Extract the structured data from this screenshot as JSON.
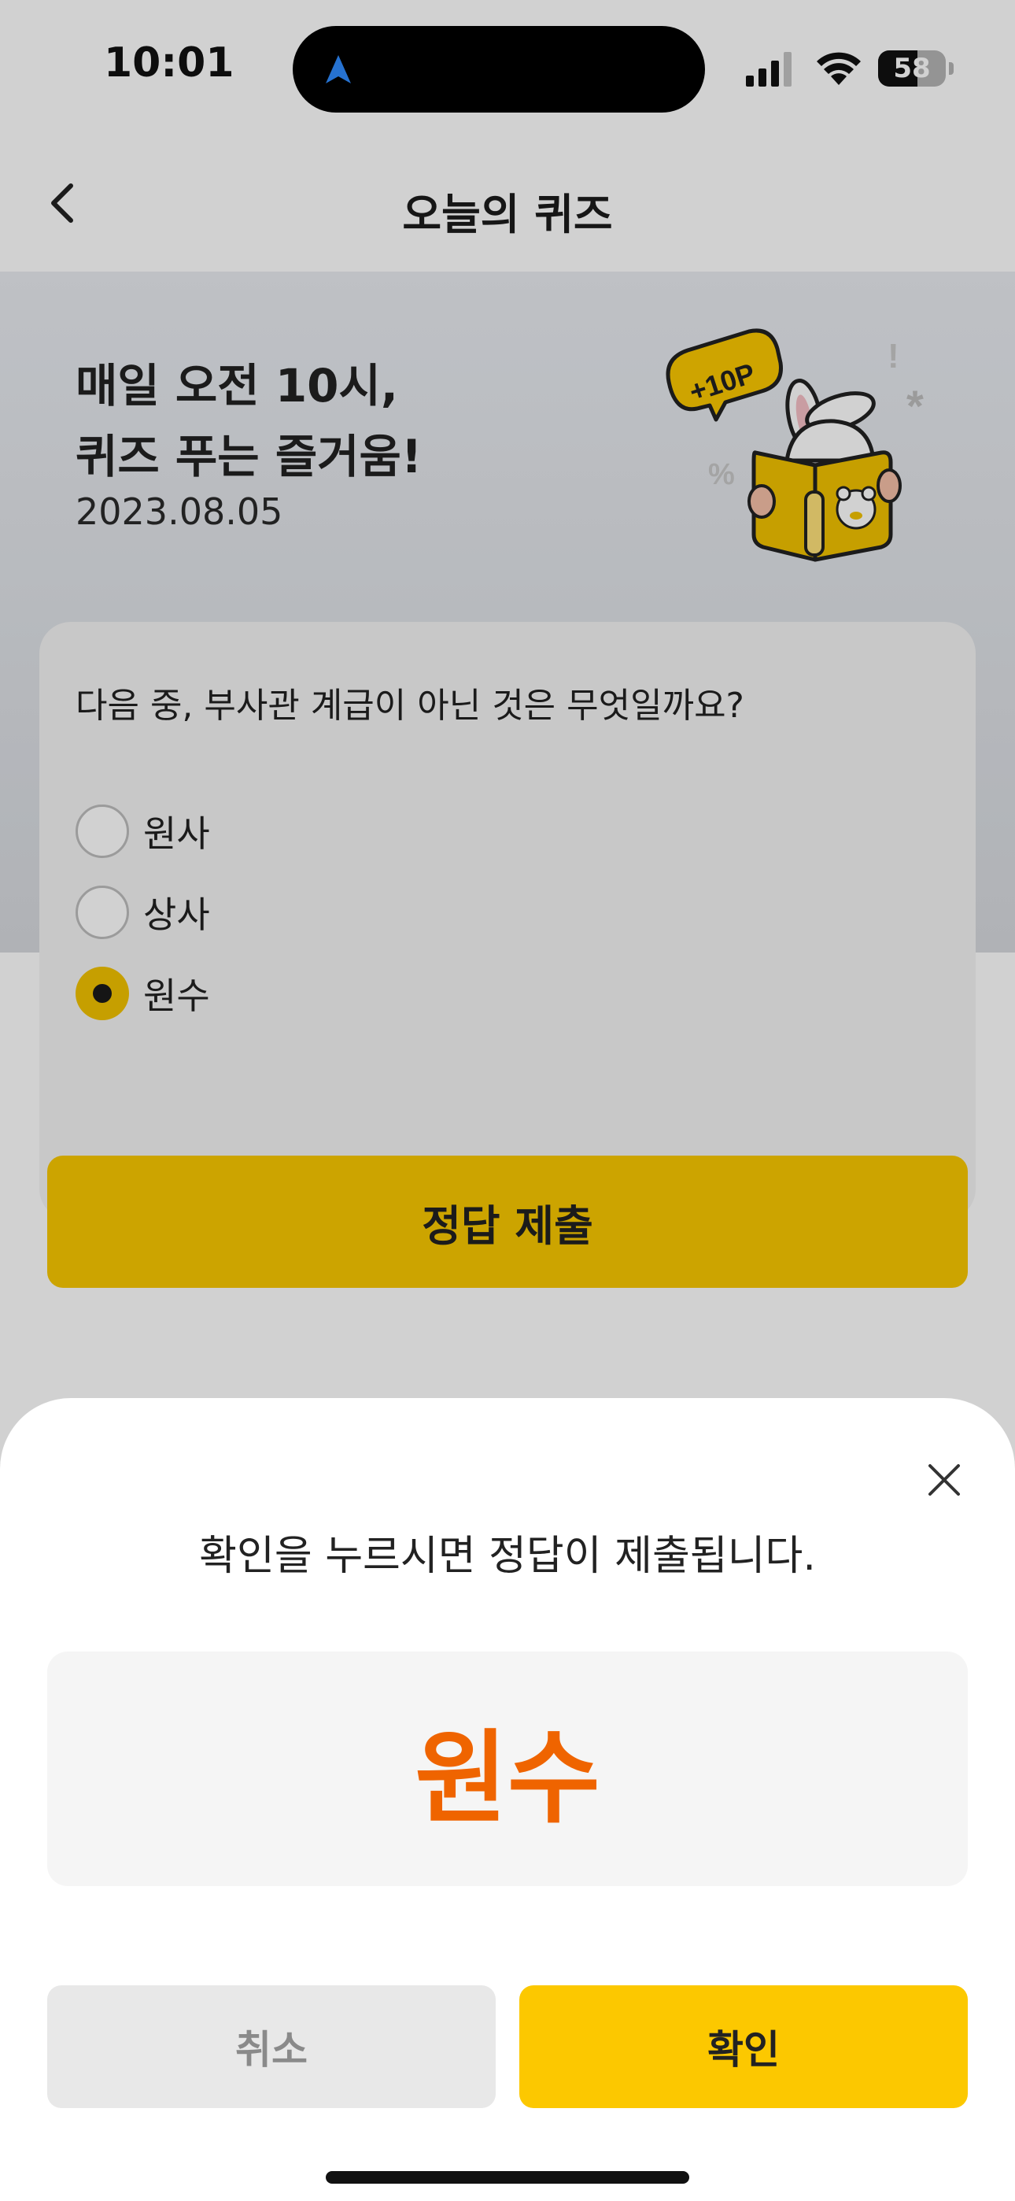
{
  "status_bar": {
    "time": "10:01",
    "battery": "58",
    "battery_level": 0.58
  },
  "nav": {
    "title": "오늘의 퀴즈"
  },
  "hero": {
    "title": "매일 오전 10시,\n퀴즈 푸는 즐거움!",
    "date": "2023.08.05",
    "badge": "+10P"
  },
  "quiz": {
    "question": "다음 중, 부사관 계급이 아닌 것은 무엇일까요?",
    "options": [
      {
        "label": "원사",
        "selected": false
      },
      {
        "label": "상사",
        "selected": false
      },
      {
        "label": "원수",
        "selected": true
      }
    ],
    "submit_label": "정답 제출"
  },
  "sheet": {
    "message": "확인을 누르시면 정답이 제출됩니다.",
    "answer": "원수",
    "cancel_label": "취소",
    "confirm_label": "확인"
  },
  "colors": {
    "accent": "#fcc800",
    "answer": "#ef6400"
  }
}
